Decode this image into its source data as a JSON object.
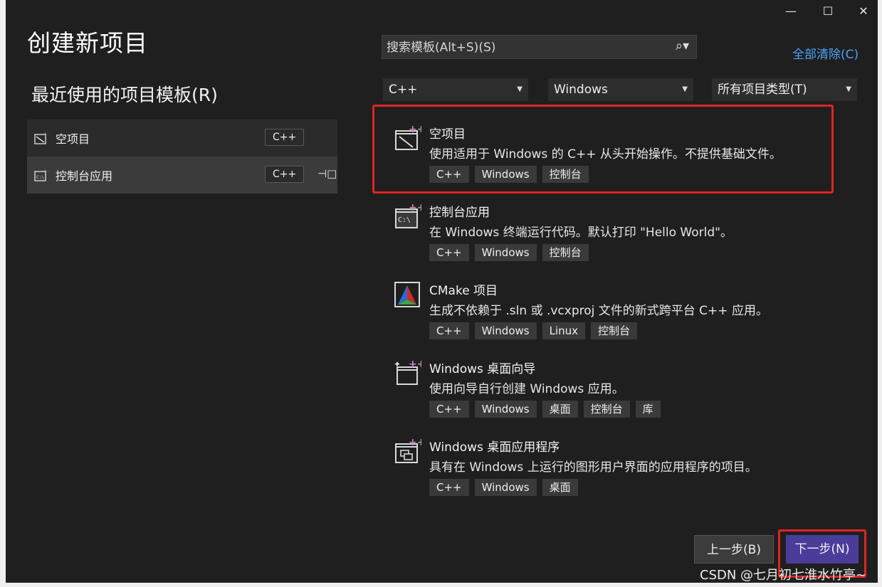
{
  "window": {
    "title": "创建新项目",
    "controls": {
      "minimize": "—",
      "maximize": "☐",
      "close": "✕"
    }
  },
  "recent": {
    "heading": "最近使用的项目模板(R)",
    "items": [
      {
        "label": "空项目",
        "tag": "C++",
        "icon": "empty-project-icon"
      },
      {
        "label": "控制台应用",
        "tag": "C++",
        "icon": "console-app-icon",
        "pin": "⊣□"
      }
    ]
  },
  "search": {
    "placeholder": "搜索模板(Alt+S)(S)",
    "icon": "⌕▾"
  },
  "clear_all": "全部清除(C)",
  "filters": {
    "language": "C++",
    "platform": "Windows",
    "project_type": "所有项目类型(T)"
  },
  "templates": [
    {
      "name": "空项目",
      "desc": "使用适用于 Windows 的 C++ 从头开始操作。不提供基础文件。",
      "tags": [
        "C++",
        "Windows",
        "控制台"
      ],
      "icon": "empty-project-icon"
    },
    {
      "name": "控制台应用",
      "desc": "在 Windows 终端运行代码。默认打印 \"Hello World\"。",
      "tags": [
        "C++",
        "Windows",
        "控制台"
      ],
      "icon": "console-app-icon"
    },
    {
      "name": "CMake 项目",
      "desc": "生成不依赖于 .sln 或 .vcxproj 文件的新式跨平台 C++ 应用。",
      "tags": [
        "C++",
        "Windows",
        "Linux",
        "控制台"
      ],
      "icon": "cmake-icon"
    },
    {
      "name": "Windows 桌面向导",
      "desc": "使用向导自行创建 Windows 应用。",
      "tags": [
        "C++",
        "Windows",
        "桌面",
        "控制台",
        "库"
      ],
      "icon": "desktop-wizard-icon"
    },
    {
      "name": "Windows 桌面应用程序",
      "desc": "具有在 Windows 上运行的图形用户界面的应用程序的项目。",
      "tags": [
        "C++",
        "Windows",
        "桌面"
      ],
      "icon": "desktop-app-icon"
    }
  ],
  "buttons": {
    "back": "上一步(B)",
    "next": "下一步(N)"
  },
  "watermark": "CSDN @七月初七淮水竹亭~",
  "colors": {
    "accent": "#4b3c9a",
    "link": "#4aa3f3",
    "highlight": "#e02424",
    "background": "#1f1f1f"
  }
}
